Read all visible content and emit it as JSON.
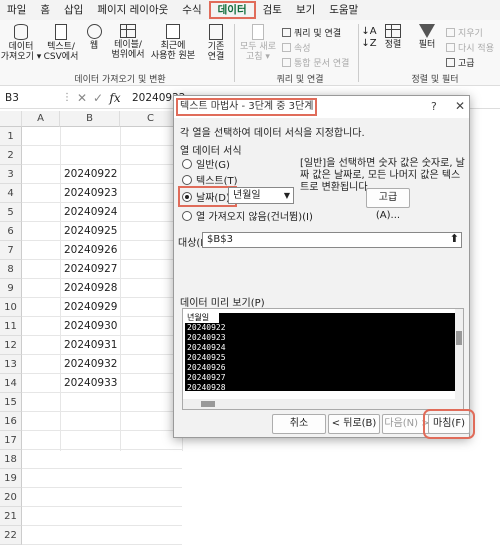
{
  "menu": [
    "파일",
    "홈",
    "삽입",
    "페이지 레이아웃",
    "수식",
    "데이터",
    "검토",
    "보기",
    "도움말"
  ],
  "ribbon": {
    "get_data": "데이터\n가져오기 ▾",
    "text_csv": "텍스트/\nCSV에서",
    "web": "웹",
    "table_range": "테이블/\n범위에서",
    "recent": "최근에\n사용한 원본",
    "existing": "기존\n연결",
    "refresh_all": "모두 새로\n고침 ▾",
    "queries": "쿼리 및 연결",
    "properties": "속성",
    "edit_links": "통합 문서 연결",
    "sort": "정렬",
    "filter": "필터",
    "clear": "지우기",
    "reapply": "다시 적용",
    "advanced": "고급",
    "group_get": "데이터 가져오기 및 변환",
    "group_query": "쿼리 및 연결",
    "group_sort": "정렬 및 필터"
  },
  "formula_bar": {
    "namebox": "B3",
    "fx": "fx",
    "value": "20240922"
  },
  "columns": [
    "A",
    "B",
    "C"
  ],
  "rows": [
    "1",
    "2",
    "3",
    "4",
    "5",
    "6",
    "7",
    "8",
    "9",
    "10",
    "11",
    "12",
    "13",
    "14",
    "15",
    "16",
    "17",
    "18",
    "19",
    "20",
    "21",
    "22"
  ],
  "cells_b": [
    "20240922",
    "20240923",
    "20240924",
    "20240925",
    "20240926",
    "20240927",
    "20240928",
    "20240929",
    "20240930",
    "20240931",
    "20240932",
    "20240933"
  ],
  "dialog": {
    "title": "텍스트 마법사 - 3단계 중 3단계",
    "help": "?",
    "close": "✕",
    "instruction": "각 열을 선택하여 데이터 서식을 지정합니다.",
    "col_format_label": "열 데이터 서식",
    "radio_general": "일반(G)",
    "radio_text": "텍스트(T)",
    "radio_date": "날짜(D):",
    "date_format": "년월일",
    "radio_skip": "열 가져오지 않음(건너뜀)(I)",
    "desc": "[일반]을 선택하면 숫자 값은 숫자로, 날짜 값은 날짜로, 모든 나머지 값은 텍스트로 변환됩니다.",
    "advanced_btn": "고급(A)...",
    "dest_label": "대상(E):",
    "dest_value": "$B$3",
    "preview_label": "데이터 미리 보기(P)",
    "preview_header": "년월일",
    "preview_rows": [
      "20240922",
      "20240923",
      "20240924",
      "20240925",
      "20240926",
      "20240927",
      "20240928"
    ],
    "btn_cancel": "취소",
    "btn_back": "< 뒤로(B)",
    "btn_next": "다음(N) >",
    "btn_finish": "마침(F)"
  }
}
